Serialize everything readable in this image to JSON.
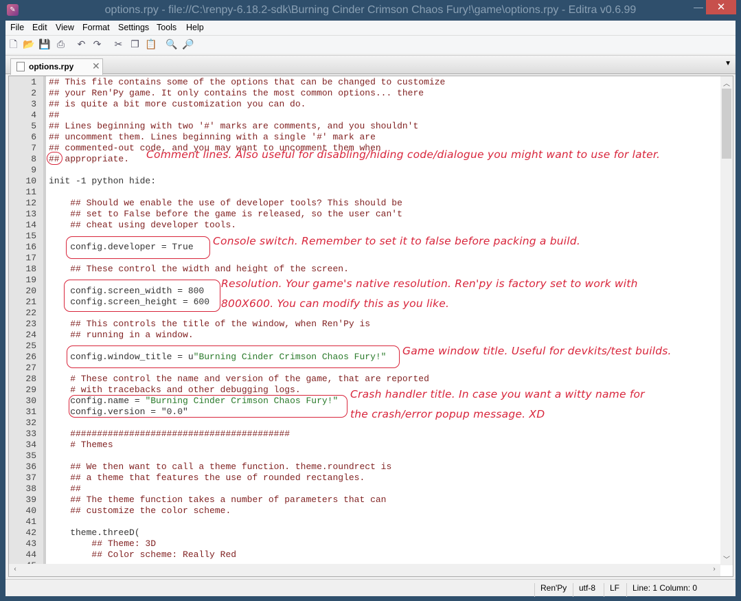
{
  "window": {
    "title": "options.rpy - file://C:\\renpy-6.18.2-sdk\\Burning Cinder Crimson Chaos Fury!\\game\\options.rpy - Editra v0.6.99",
    "app_icon": "editra-icon",
    "minimize": "—",
    "close": "✕"
  },
  "menu": [
    "File",
    "Edit",
    "View",
    "Format",
    "Settings",
    "Tools",
    "Help"
  ],
  "toolbar": [
    {
      "icon": "new-file-icon",
      "g": "🗋"
    },
    {
      "icon": "open-folder-icon",
      "g": "📂"
    },
    {
      "icon": "save-icon",
      "g": "💾"
    },
    {
      "icon": "print-icon",
      "g": "⎙"
    },
    {
      "icon": "undo-icon",
      "g": "↶"
    },
    {
      "icon": "redo-icon",
      "g": "↷"
    },
    {
      "icon": "cut-icon",
      "g": "✂"
    },
    {
      "icon": "copy-icon",
      "g": "❐"
    },
    {
      "icon": "paste-icon",
      "g": "📋"
    },
    {
      "icon": "find-icon",
      "g": "🔍"
    },
    {
      "icon": "find-replace-icon",
      "g": "🔎"
    }
  ],
  "tab": {
    "label": "options.rpy",
    "close": "✕",
    "menu": "▼"
  },
  "colors": {
    "comment": "#7f1f1f",
    "code": "#333333",
    "string": "#2a7a2a",
    "annotation": "#d8253b",
    "close_button": "#c7504c"
  },
  "lines": [
    [
      [
        "## This file contains some of the options that can be changed to customize",
        "comment"
      ]
    ],
    [
      [
        "## your Ren'Py game. It only contains the most common options... there",
        "comment"
      ]
    ],
    [
      [
        "## is quite a bit more customization you can do.",
        "comment"
      ]
    ],
    [
      [
        "##",
        "comment"
      ]
    ],
    [
      [
        "## Lines beginning with two '#' marks are comments, and you shouldn't",
        "comment"
      ]
    ],
    [
      [
        "## uncomment them. Lines beginning with a single '#' mark are",
        "comment"
      ]
    ],
    [
      [
        "## commented-out code, and you may want to uncomment them when",
        "comment"
      ]
    ],
    [
      [
        "## appropriate.",
        "comment"
      ]
    ],
    [],
    [
      [
        "init -1 python hide:",
        "code"
      ]
    ],
    [],
    [
      [
        "    ## Should we enable the use of developer tools? This should be",
        "comment"
      ]
    ],
    [
      [
        "    ## set to False before the game is released, so the user can't",
        "comment"
      ]
    ],
    [
      [
        "    ## cheat using developer tools.",
        "comment"
      ]
    ],
    [],
    [
      [
        "    config.developer = True",
        "code"
      ]
    ],
    [],
    [
      [
        "    ## These control the width and height of the screen.",
        "comment"
      ]
    ],
    [],
    [
      [
        "    config.screen_width = 800",
        "code"
      ]
    ],
    [
      [
        "    config.screen_height = 600",
        "code"
      ]
    ],
    [],
    [
      [
        "    ## This controls the title of the window, when Ren'Py is",
        "comment"
      ]
    ],
    [
      [
        "    ## running in a window.",
        "comment"
      ]
    ],
    [],
    [
      [
        "    config.window_title = u",
        "code"
      ],
      [
        "\"Burning Cinder Crimson Chaos Fury!\"",
        "str"
      ]
    ],
    [],
    [
      [
        "    # These control the name and version of the game, that are reported",
        "comment"
      ]
    ],
    [
      [
        "    # with tracebacks and other debugging logs.",
        "comment"
      ]
    ],
    [
      [
        "    config.name = ",
        "code"
      ],
      [
        "\"Burning Cinder Crimson Chaos Fury!\"",
        "str"
      ]
    ],
    [
      [
        "    config.version = \"0.0\"",
        "code"
      ]
    ],
    [],
    [
      [
        "    #########################################",
        "comment"
      ]
    ],
    [
      [
        "    # Themes",
        "comment"
      ]
    ],
    [],
    [
      [
        "    ## We then want to call a theme function. theme.roundrect is",
        "comment"
      ]
    ],
    [
      [
        "    ## a theme that features the use of rounded rectangles.",
        "comment"
      ]
    ],
    [
      [
        "    ##",
        "comment"
      ]
    ],
    [
      [
        "    ## The theme function takes a number of parameters that can",
        "comment"
      ]
    ],
    [
      [
        "    ## customize the color scheme.",
        "comment"
      ]
    ],
    [],
    [
      [
        "    theme.threeD(",
        "code"
      ]
    ],
    [
      [
        "        ## Theme: 3D",
        "comment"
      ]
    ],
    [
      [
        "        ## Color scheme: Really Red",
        "comment"
      ]
    ],
    []
  ],
  "annotations": {
    "comment": "Comment lines. Also useful for disabling/hiding code/dialogue you might want to use for later.",
    "console": "Console switch. Remember to set it to false before packing a build.",
    "resolution_1": "Resolution. Your game's native resolution. Ren'py is factory set to work with",
    "resolution_2": "800X600. You can modify this as you like.",
    "title": "Game window title. Useful for devkits/test builds.",
    "crash_1": "Crash handler title. In case you want a witty name for",
    "crash_2": "the crash/error popup message. XD"
  },
  "status": {
    "lexer": "Ren'Py",
    "encoding": "utf-8",
    "eol": "LF",
    "position": "Line: 1  Column: 0"
  }
}
